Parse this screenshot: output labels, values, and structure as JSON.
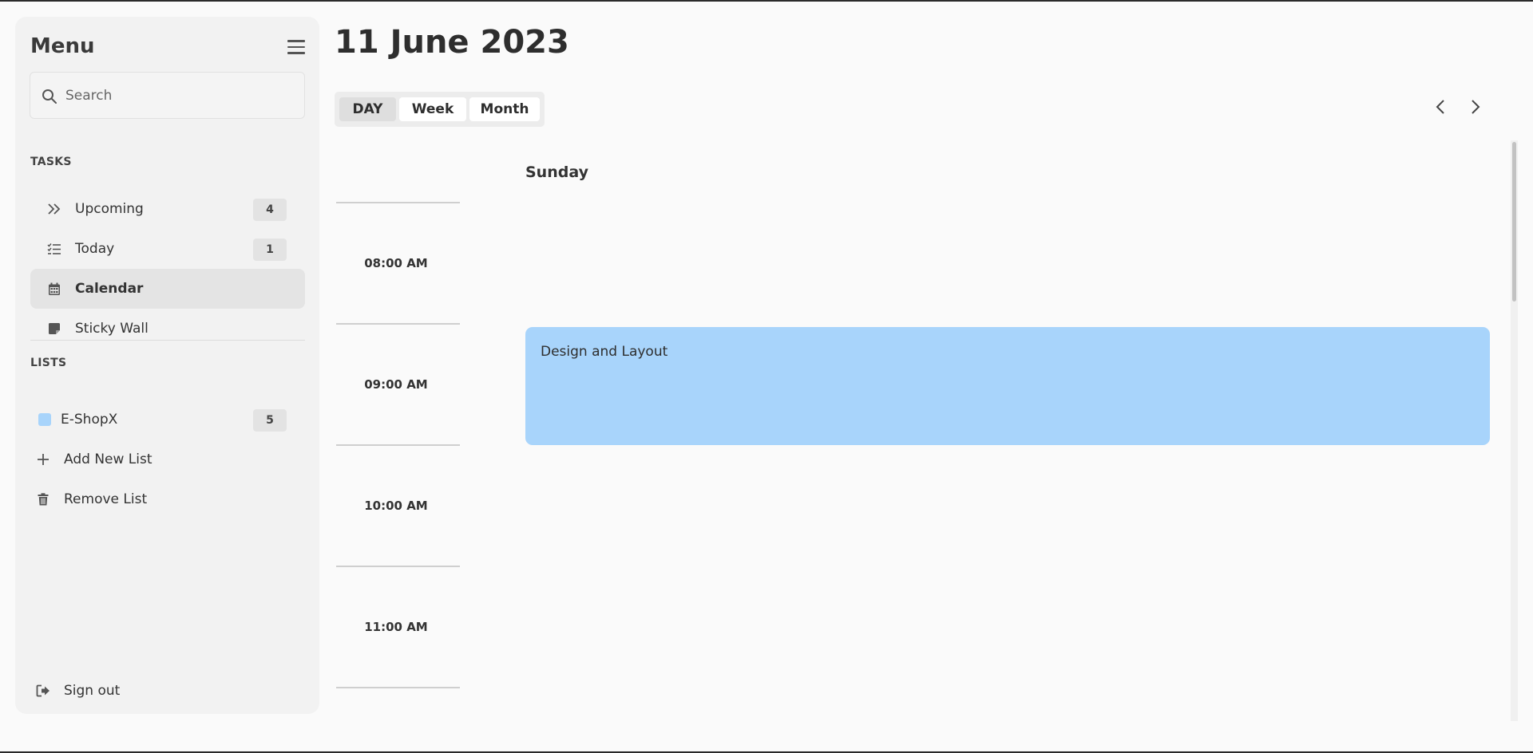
{
  "sidebar": {
    "title": "Menu",
    "search": {
      "placeholder": "Search",
      "value": ""
    },
    "tasks_label": "TASKS",
    "tasks": [
      {
        "label": "Upcoming",
        "count": "4",
        "icon": "double-chevron-right-icon"
      },
      {
        "label": "Today",
        "count": "1",
        "icon": "checklist-icon"
      },
      {
        "label": "Calendar",
        "icon": "calendar-icon",
        "active": true
      },
      {
        "label": "Sticky Wall",
        "icon": "sticky-note-icon"
      }
    ],
    "lists_label": "LISTS",
    "lists": [
      {
        "label": "E-ShopX",
        "count": "5",
        "color": "#a8d4fb"
      }
    ],
    "add_list": "Add New List",
    "remove_list": "Remove List",
    "sign_out": "Sign out"
  },
  "header": {
    "date": "11 June 2023",
    "views": [
      "DAY",
      "Week",
      "Month"
    ],
    "active_view": "DAY"
  },
  "calendar": {
    "day_name": "Sunday",
    "times": [
      "08:00 AM",
      "09:00 AM",
      "10:00 AM",
      "11:00 AM"
    ],
    "events": [
      {
        "title": "Design and Layout",
        "color": "#a8d4fb"
      }
    ]
  }
}
